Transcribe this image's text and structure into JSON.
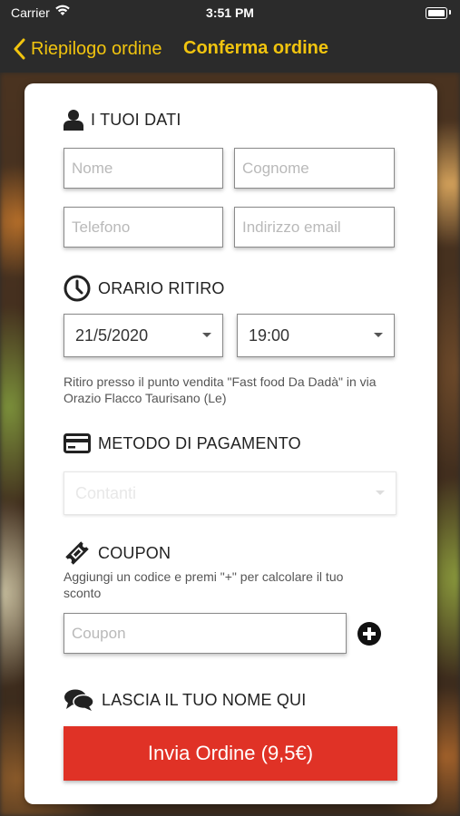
{
  "status_bar": {
    "carrier": "Carrier",
    "time": "3:51 PM"
  },
  "nav": {
    "back_label": "Riepilogo ordine",
    "title": "Conferma ordine",
    "accent_color": "#f1c40f"
  },
  "sections": {
    "personal": {
      "title": "I TUOI DATI",
      "name_placeholder": "Nome",
      "surname_placeholder": "Cognome",
      "phone_placeholder": "Telefono",
      "email_placeholder": "Indirizzo email"
    },
    "pickup": {
      "title": "ORARIO RITIRO",
      "date_value": "21/5/2020",
      "time_value": "19:00",
      "note": "Ritiro presso il punto vendita \"Fast food Da Dadà\" in via Orazio Flacco Taurisano (Le)"
    },
    "payment": {
      "title": "METODO DI PAGAMENTO",
      "selected": "Contanti"
    },
    "coupon": {
      "title": "COUPON",
      "note": "Aggiungi un codice e premi \"+\" per calcolare il tuo sconto",
      "placeholder": "Coupon"
    },
    "name_note": {
      "title": "LASCIA IL TUO NOME QUI"
    }
  },
  "submit": {
    "label": "Invia Ordine (9,5€)",
    "color": "#e03226"
  },
  "icons": [
    "wifi-icon",
    "battery-icon",
    "chevron-left-icon",
    "user-icon",
    "clock-icon",
    "credit-card-icon",
    "ticket-icon",
    "plus-circle-icon",
    "chat-bubbles-icon"
  ]
}
